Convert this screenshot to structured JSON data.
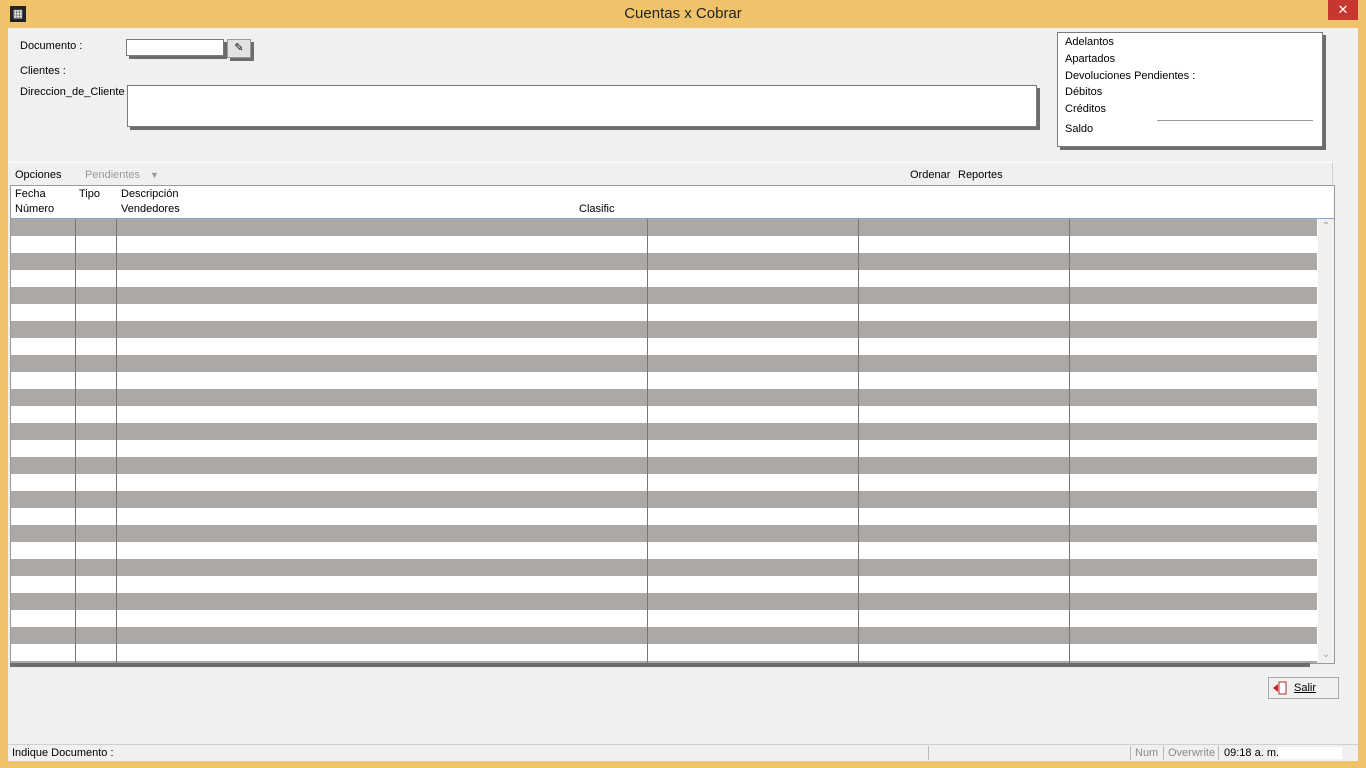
{
  "window": {
    "title": "Cuentas x Cobrar",
    "close_label": "✕",
    "app_icon": "app-icon"
  },
  "form": {
    "documento_label": "Documento  :",
    "documento_value": "",
    "search_button_label": "✎",
    "clientes_label": "Clientes  :",
    "direccion_label": "Direccion_de_Cliente",
    "direccion_value": ""
  },
  "summary": {
    "adelantos": "Adelantos",
    "apartados": "Apartados",
    "devoluciones": "Devoluciones Pendientes :",
    "debitos": "Débitos",
    "creditos": "Créditos",
    "saldo": "Saldo"
  },
  "menu": {
    "opciones": "Opciones",
    "pendientes": "Pendientes",
    "pendientes_arrow": "▼",
    "ordenar": "Ordenar",
    "reportes": "Reportes"
  },
  "grid": {
    "headers": {
      "fecha": "Fecha",
      "numero": "Número",
      "tipo": "Tipo",
      "descripcion": "Descripción",
      "vendedores": "Vendedores",
      "clasific": "Clasific"
    },
    "scroll_up": "⌃",
    "scroll_down": "⌄"
  },
  "buttons": {
    "salir": "Salir"
  },
  "status": {
    "message": "Indique Documento  :",
    "num": "Num",
    "overwrite": "Overwrite",
    "time": "09:18 a. m."
  },
  "colors": {
    "title_bar": "#f0c36a",
    "close": "#c7372f",
    "row_alt": "#aca8a6"
  }
}
